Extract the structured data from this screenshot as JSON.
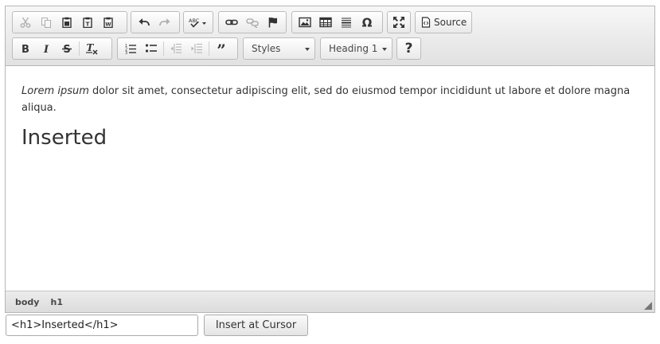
{
  "toolbar": {
    "source_label": "Source",
    "styles_label": "Styles",
    "format_label": "Heading 1",
    "help_label": "?"
  },
  "content": {
    "para_italic": "Lorem ipsum",
    "para_rest": " dolor sit amet, consectetur adipiscing elit, sed do eiusmod tempor incididunt ut labore et dolore magna aliqua.",
    "heading": "Inserted"
  },
  "path": [
    "body",
    "h1"
  ],
  "controls": {
    "html_value": "<h1>Inserted</h1>",
    "insert_label": "Insert at Cursor"
  },
  "icons": {
    "row1": [
      "cut-icon",
      "copy-icon",
      "paste-icon",
      "paste-text-icon",
      "paste-word-icon",
      "undo-icon",
      "redo-icon",
      "spellcheck-icon",
      "link-icon",
      "unlink-icon",
      "anchor-icon",
      "image-icon",
      "table-icon",
      "horizontal-rule-icon",
      "special-char-icon",
      "maximize-icon",
      "source-icon"
    ],
    "row2": [
      "bold-icon",
      "italic-icon",
      "strike-icon",
      "remove-format-icon",
      "numbered-list-icon",
      "bulleted-list-icon",
      "outdent-icon",
      "indent-icon",
      "blockquote-icon"
    ]
  }
}
